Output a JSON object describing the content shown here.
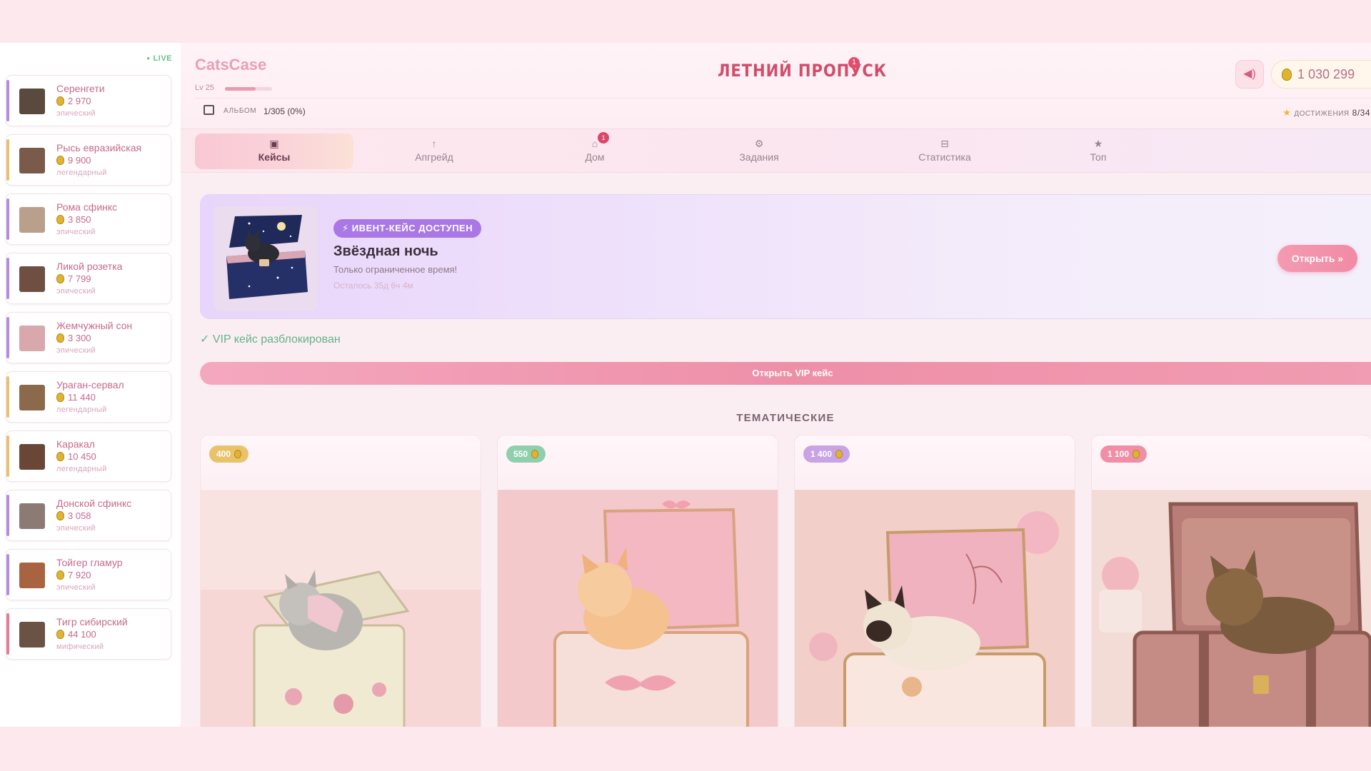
{
  "sidebar": {
    "live_label": "LIVE",
    "items": [
      {
        "name": "Серенгети",
        "price": "2 970",
        "rarity": "эпический",
        "color": "#b58be0"
      },
      {
        "name": "Рысь евразийская",
        "price": "9 900",
        "rarity": "легендарный",
        "color": "#e8c070"
      },
      {
        "name": "Рома сфинкс",
        "price": "3 850",
        "rarity": "эпический",
        "color": "#b58be0"
      },
      {
        "name": "Ликой розетка",
        "price": "7 799",
        "rarity": "эпический",
        "color": "#b58be0"
      },
      {
        "name": "Жемчужный сон",
        "price": "3 300",
        "rarity": "эпический",
        "color": "#b58be0"
      },
      {
        "name": "Ураган-сервал",
        "price": "11 440",
        "rarity": "легендарный",
        "color": "#e8c070"
      },
      {
        "name": "Каракал",
        "price": "10 450",
        "rarity": "легендарный",
        "color": "#e8c070"
      },
      {
        "name": "Донской сфинкс",
        "price": "3 058",
        "rarity": "эпический",
        "color": "#b58be0"
      },
      {
        "name": "Тойгер гламур",
        "price": "7 920",
        "rarity": "эпический",
        "color": "#b58be0"
      },
      {
        "name": "Тигр сибирский",
        "price": "44 100",
        "rarity": "мифический",
        "color": "#e67a96"
      }
    ]
  },
  "header": {
    "brand": "CatsCase",
    "level_label": "Lv 25",
    "level_progress": 0.65,
    "album_label": "АЛЬБОМ",
    "album_value": "1/305 (0%)",
    "summer_pass": "ЛЕТНИЙ ПРОПУСК",
    "summer_badge": "1",
    "balance": "1 030 299",
    "achievements_label": "ДОСТИЖЕНИЯ",
    "achievements_value": "8/34",
    "sound_icon": "speaker-icon"
  },
  "tabs": [
    {
      "label": "Кейсы",
      "icon": "▣",
      "icon_name": "cases-icon"
    },
    {
      "label": "Апгрейд",
      "icon": "↑",
      "icon_name": "upgrade-icon"
    },
    {
      "label": "Дом",
      "icon": "⌂",
      "icon_name": "home-icon",
      "badge": "1"
    },
    {
      "label": "Задания",
      "icon": "⚙",
      "icon_name": "tasks-icon"
    },
    {
      "label": "Статистика",
      "icon": "⊟",
      "icon_name": "stats-icon"
    },
    {
      "label": "Топ",
      "icon": "★",
      "icon_name": "top-icon"
    }
  ],
  "event": {
    "tag": "⚡ ИВЕНТ-КЕЙС ДОСТУПЕН",
    "title": "Звёздная ночь",
    "subtitle": "Только ограниченное время!",
    "time_left": "Осталось 35д 6ч 4м",
    "open_label": "Открыть »"
  },
  "vip": {
    "note": "✓ VIP кейс разблокирован",
    "button": "Открыть VIP кейс"
  },
  "section_title": "ТЕМАТИЧЕСКИЕ",
  "cases": [
    {
      "price": "400",
      "color": "#e8c36a"
    },
    {
      "price": "550",
      "color": "#8fcfae"
    },
    {
      "price": "1 400",
      "color": "#c9a3e3"
    },
    {
      "price": "1 100",
      "color": "#ef8ea6"
    }
  ]
}
